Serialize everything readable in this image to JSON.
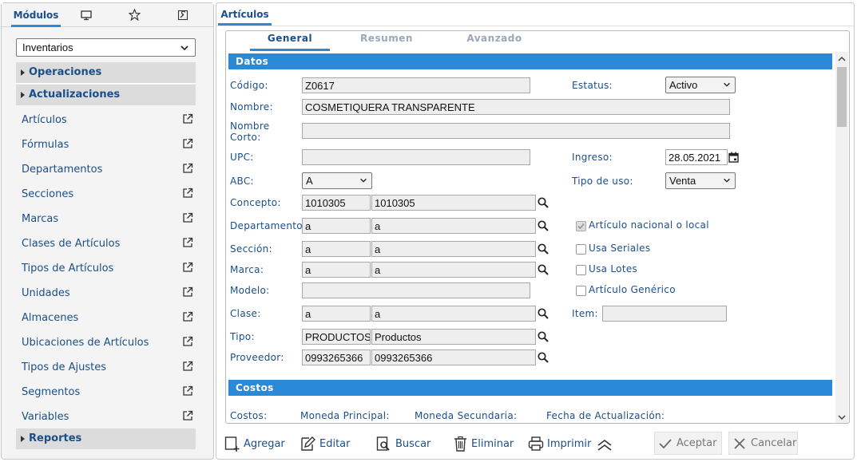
{
  "left": {
    "tabs": {
      "modules_label": "Módulos"
    },
    "module_select": "Inventarios",
    "sections": {
      "operaciones": "Operaciones",
      "actualizaciones": "Actualizaciones",
      "reportes": "Reportes"
    },
    "items": [
      "Artículos",
      "Fórmulas",
      "Departamentos",
      "Secciones",
      "Marcas",
      "Clases de Artículos",
      "Tipos de Artículos",
      "Unidades",
      "Almacenes",
      "Ubicaciones de Artículos",
      "Tipos de Ajustes",
      "Segmentos",
      "Variables"
    ]
  },
  "right": {
    "tab": "Artículos",
    "subtabs": {
      "general": "General",
      "resumen": "Resumen",
      "avanzado": "Avanzado"
    },
    "bands": {
      "datos": "Datos",
      "costos": "Costos"
    },
    "labels": {
      "codigo": "Código:",
      "nombre": "Nombre:",
      "nombre_corto_1": "Nombre",
      "nombre_corto_2": "Corto:",
      "upc": "UPC:",
      "abc": "ABC:",
      "concepto": "Concepto:",
      "departamento": "Departamento:",
      "seccion": "Sección:",
      "marca": "Marca:",
      "modelo": "Modelo:",
      "clase": "Clase:",
      "tipo": "Tipo:",
      "proveedor": "Proveedor:",
      "estatus": "Estatus:",
      "ingreso": "Ingreso:",
      "tipo_uso": "Tipo de uso:",
      "item": "Item:"
    },
    "values": {
      "codigo": "Z0617",
      "nombre": "COSMETIQUERA TRANSPARENTE",
      "nombre_corto": "",
      "upc": "",
      "abc": "A",
      "concepto_code": "1010305",
      "concepto_desc": "1010305",
      "departamento_code": "a",
      "departamento_desc": "a",
      "seccion_code": "a",
      "seccion_desc": "a",
      "marca_code": "a",
      "marca_desc": "a",
      "modelo": "",
      "clase_code": "a",
      "clase_desc": "a",
      "tipo_code": "PRODUCTOS",
      "tipo_desc": "Productos",
      "proveedor_code": "0993265366",
      "proveedor_desc": "0993265366",
      "estatus": "Activo",
      "ingreso": "28.05.2021",
      "tipo_uso": "Venta",
      "item": ""
    },
    "checkboxes": {
      "nacional": "Artículo nacional o local",
      "seriales": "Usa Seriales",
      "lotes": "Usa Lotes",
      "generico": "Artículo Genérico"
    },
    "costos": {
      "costos": "Costos:",
      "moneda_principal": "Moneda Principal:",
      "moneda_secundaria": "Moneda Secundaria:",
      "fecha_actualizacion": "Fecha de Actualización:"
    },
    "toolbar": {
      "agregar": "Agregar",
      "editar": "Editar",
      "buscar": "Buscar",
      "eliminar": "Eliminar",
      "imprimir": "Imprimir",
      "aceptar": "Aceptar",
      "cancelar": "Cancelar"
    }
  },
  "colors": {
    "accent": "#2b8ad8",
    "label": "#1b4f8a",
    "field_bg": "#eeeeee"
  }
}
